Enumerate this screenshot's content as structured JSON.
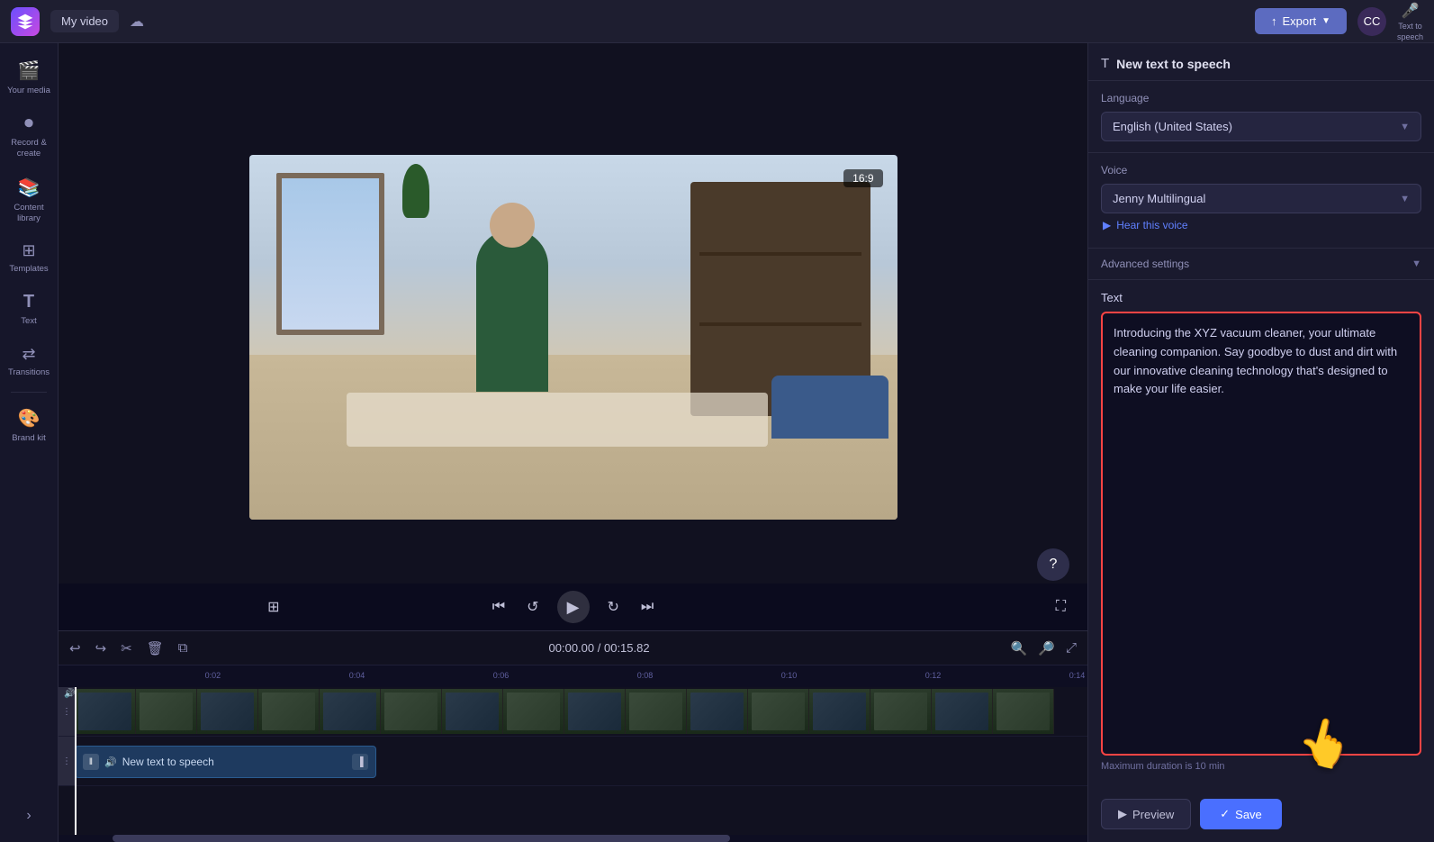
{
  "topbar": {
    "project_name": "My video",
    "export_label": "Export"
  },
  "sidebar": {
    "items": [
      {
        "id": "your-media",
        "label": "Your media",
        "icon": "🎬"
      },
      {
        "id": "record-create",
        "label": "Record &\ncreate",
        "icon": "⏺"
      },
      {
        "id": "content-library",
        "label": "Content library",
        "icon": "📚"
      },
      {
        "id": "templates",
        "label": "Templates",
        "icon": "⊞"
      },
      {
        "id": "text",
        "label": "Text",
        "icon": "T"
      },
      {
        "id": "transitions",
        "label": "Transitions",
        "icon": "↔"
      },
      {
        "id": "brand-kit",
        "label": "Brand kit",
        "icon": "🎨"
      }
    ]
  },
  "video_preview": {
    "aspect_ratio": "16:9"
  },
  "timeline": {
    "time_current": "00:00.00",
    "time_total": "00:15.82",
    "ruler_marks": [
      "0:02",
      "0:04",
      "0:06",
      "0:08",
      "0:10",
      "0:12",
      "0:14"
    ],
    "tts_track_label": "New text to speech"
  },
  "tts_panel": {
    "title": "New text to speech",
    "language_label": "Language",
    "language_value": "English (United States)",
    "voice_label": "Voice",
    "voice_value": "Jenny Multilingual",
    "hear_voice_label": "Hear this voice",
    "advanced_settings_label": "Advanced settings",
    "text_section_label": "Text",
    "text_content": "Introducing the XYZ vacuum cleaner, your ultimate cleaning companion. Say goodbye to dust and dirt with our innovative cleaning technology that's designed to make your life easier.",
    "max_duration_label": "Maximum duration is 10 min",
    "preview_label": "Preview",
    "save_label": "Save"
  }
}
